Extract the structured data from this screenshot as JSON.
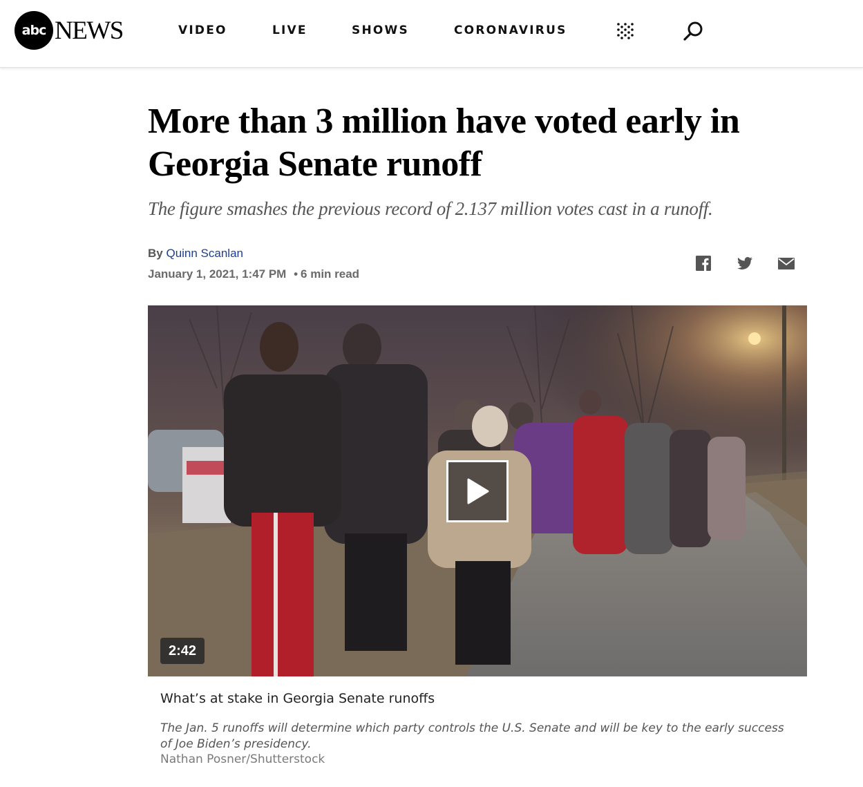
{
  "header": {
    "logo_mark": "abc",
    "logo_text": "NEWS",
    "nav": [
      {
        "label": "VIDEO"
      },
      {
        "label": "LIVE"
      },
      {
        "label": "SHOWS"
      },
      {
        "label": "CORONAVIRUS"
      }
    ],
    "menu_icon": "grid-dots-icon",
    "search_icon": "search-icon"
  },
  "article": {
    "headline": "More than 3 million have voted early in Georgia Senate runoff",
    "subhead": "The figure smashes the previous record of 2.137 million votes cast in a runoff.",
    "byline_prefix": "By",
    "author": "Quinn Scanlan",
    "date": "January 1, 2021, 1:47 PM",
    "separator": "•",
    "read_time": "6 min read",
    "share": [
      {
        "icon": "facebook-icon"
      },
      {
        "icon": "twitter-icon"
      },
      {
        "icon": "email-icon"
      }
    ]
  },
  "video": {
    "duration": "2:42",
    "title": "What’s at stake in Georgia Senate runoffs",
    "caption": "The Jan. 5 runoffs will determine which party controls the U.S. Senate and will be key to the early success of Joe Biden’s presidency.",
    "credit": "Nathan Posner/Shutterstock",
    "play_icon": "play-icon"
  },
  "colors": {
    "author_link": "#1c3f94",
    "meta_gray": "#6a6a6a",
    "subhead_gray": "#555555"
  }
}
